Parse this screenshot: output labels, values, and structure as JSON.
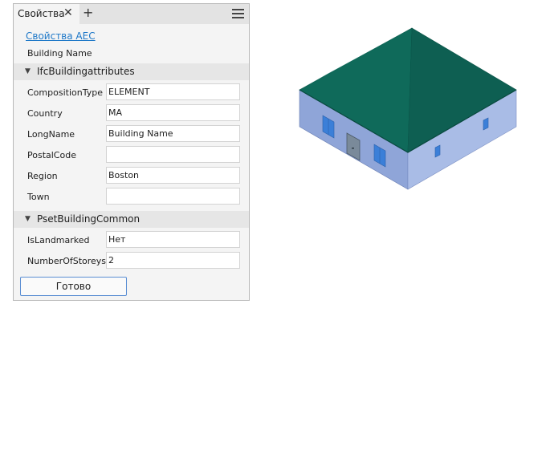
{
  "panel": {
    "tab_title": "Свойства",
    "close_glyph": "✕",
    "add_glyph": "+",
    "link_label": "Свойства AEC",
    "element_name": "Building Name",
    "sections": [
      {
        "title": "IfcBuildingattributes",
        "props": [
          {
            "label": "CompositionType",
            "value": "ELEMENT"
          },
          {
            "label": "Country",
            "value": "MA"
          },
          {
            "label": "LongName",
            "value": "Building Name"
          },
          {
            "label": "PostalCode",
            "value": ""
          },
          {
            "label": "Region",
            "value": "Boston"
          },
          {
            "label": "Town",
            "value": ""
          }
        ]
      },
      {
        "title": "PsetBuildingCommon",
        "props": [
          {
            "label": "IsLandmarked",
            "value": "Нет"
          },
          {
            "label": "NumberOfStoreys",
            "value": "2"
          }
        ]
      }
    ],
    "done_label": "Готово"
  },
  "colors": {
    "accent": "#1e78c8",
    "roof": "#0f6a5a",
    "wall_left": "#8fa5d8",
    "wall_right": "#a9bce6",
    "window": "#3b7fd8"
  },
  "icons": {
    "close": "close-icon",
    "add": "plus-icon",
    "menu": "hamburger-menu-icon",
    "expand": "triangle-down-icon"
  }
}
